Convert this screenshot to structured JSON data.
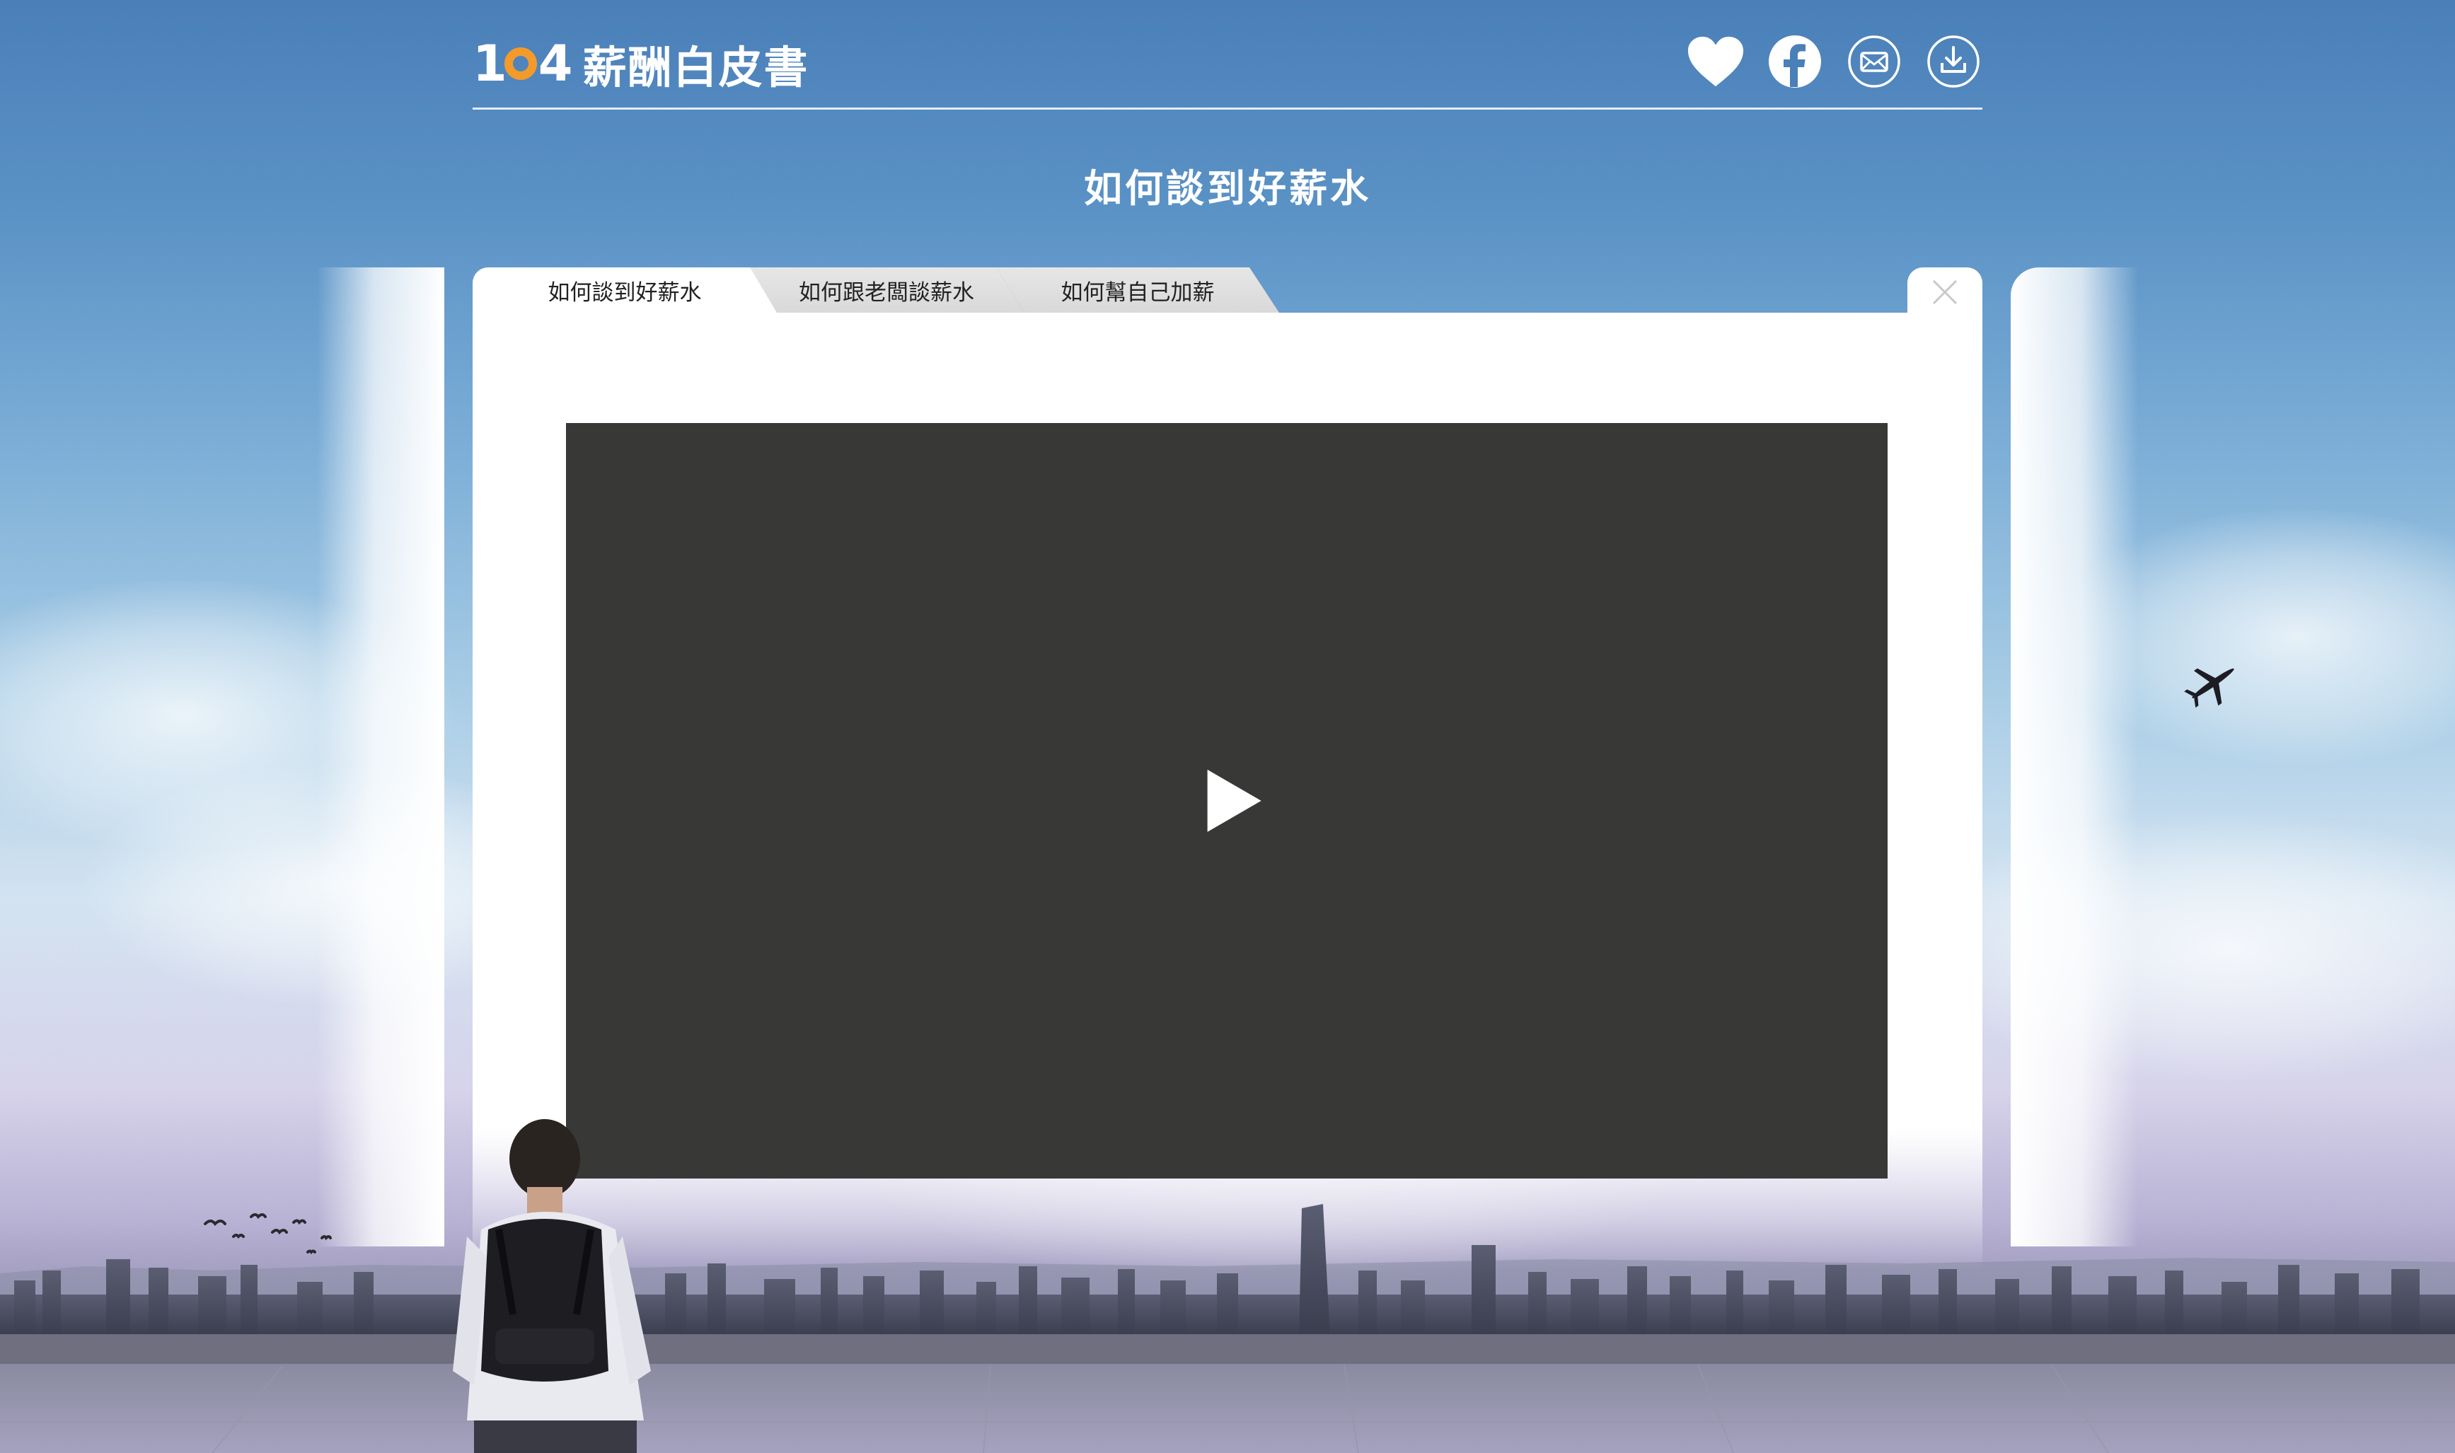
{
  "header": {
    "logo_number": "104",
    "logo_text": "薪酬白皮書",
    "icons": [
      "heart-icon",
      "facebook-icon",
      "mail-icon",
      "download-icon"
    ]
  },
  "page_title": "如何談到好薪水",
  "tabs": [
    {
      "label": "如何談到好薪水",
      "active": true
    },
    {
      "label": "如何跟老闆談薪水",
      "active": false
    },
    {
      "label": "如何幫自己加薪",
      "active": false
    }
  ],
  "video": {
    "state": "paused",
    "background": "#383837"
  },
  "colors": {
    "accent_orange": "#f39a2b",
    "sky_top": "#4a7fb8",
    "tab_inactive": "#dcdcdc"
  }
}
